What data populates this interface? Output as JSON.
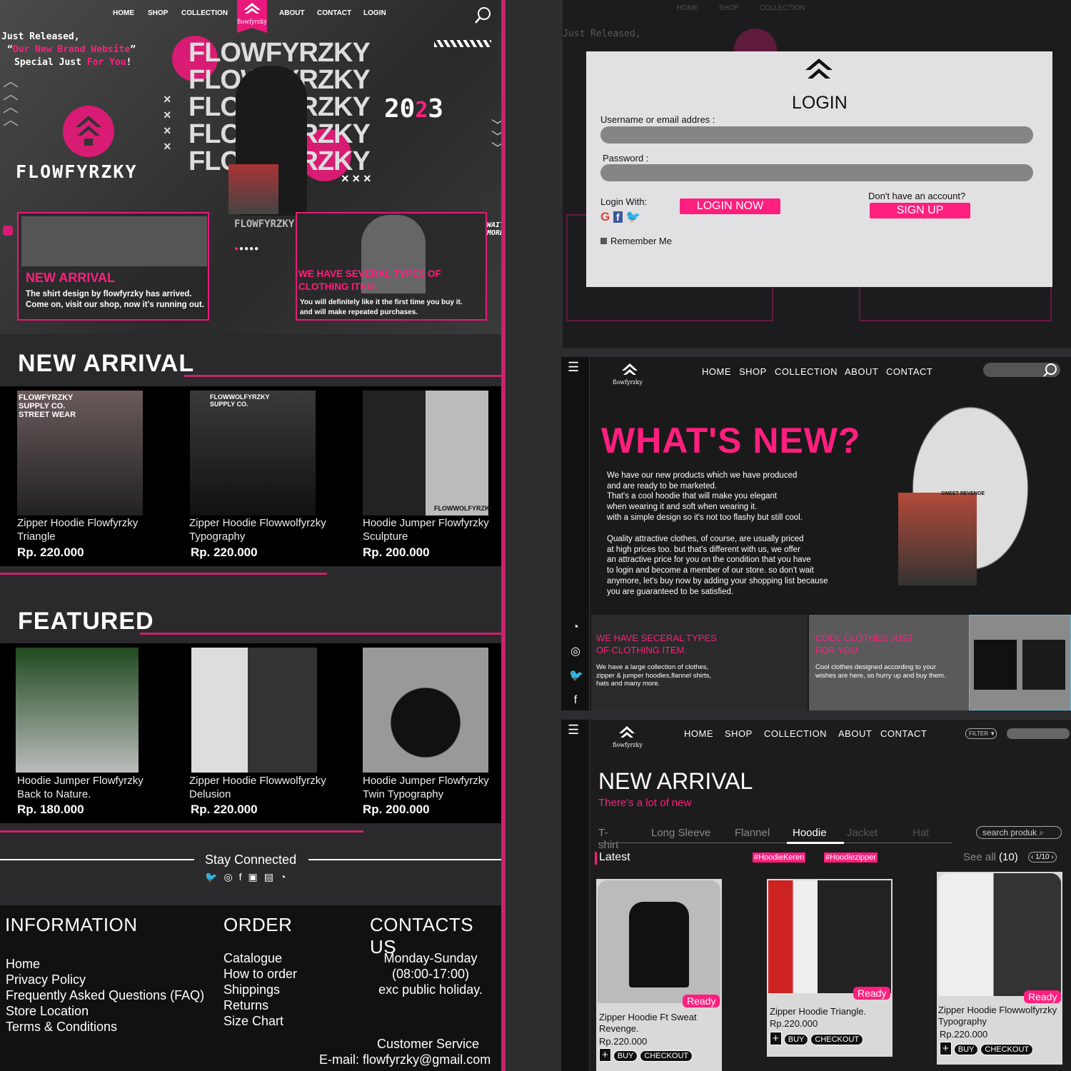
{
  "nav": {
    "home": "HOME",
    "shop": "SHOP",
    "collection": "COLLECTION",
    "about": "ABOUT",
    "contact": "CONTACT",
    "login": "LOGIN",
    "brand": "flowfyrzky"
  },
  "hero": {
    "l1": "Just Released,",
    "l2a": "“",
    "l2b": "Our New Brand Website",
    "l2c": "”",
    "l3a": "Special Just ",
    "l3b": "For You",
    "l3c": "!",
    "wordmark": "FLOWFYRZKY",
    "stack": [
      "FLOWFYRZKY",
      "FLOWFYRZKY",
      "FLOWFYRZKY",
      "FLOWFYRZKY",
      "FLOWFYRZKY"
    ],
    "year_a": "20",
    "year_b": "2",
    "year_c": "3",
    "logo_text": "FLOWFYRZKY",
    "wait": "WAIT",
    "more": "MORE"
  },
  "promo": [
    {
      "title": "NEW ARRIVAL",
      "body": "The shirt design by flowfyrzky has arrived. Come on, visit our shop, now it's running out."
    },
    {
      "title": "WE HAVE SEVERAL TYPES OF CLOTHING ITEM.",
      "body": "You will definitely like it the first time you buy it. and will make repeated purchases."
    }
  ],
  "new_arrival": {
    "title": "NEW ARRIVAL",
    "items": [
      {
        "name": "Zipper Hoodie Flowfyrzky Triangle",
        "price": "Rp. 220.000",
        "img_label": "FLOWFYRZKY SUPPLY CO. STREET WEAR"
      },
      {
        "name": "Zipper Hoodie Flowwolfyrzky Typography",
        "price": "Rp. 220.000",
        "img_label": "FLOWWOLFYRZKY SUPPLY CO."
      },
      {
        "name": "Hoodie Jumper Flowfyrzky Sculpture",
        "price": "Rp. 200.000",
        "img_label": "FLOWWOLFYRZKY"
      }
    ]
  },
  "featured": {
    "title": "FEATURED",
    "items": [
      {
        "name": "Hoodie Jumper Flowfyrzky Back to Nature.",
        "price": "Rp. 180.000"
      },
      {
        "name": "Zipper Hoodie Flowwolfyrzky Delusion",
        "price": "Rp. 220.000"
      },
      {
        "name": "Hoodie Jumper Flowfyrzky Twin Typography",
        "price": "Rp. 200.000"
      }
    ]
  },
  "stay": "Stay Connected",
  "footer": {
    "info_title": "INFORMATION",
    "info": [
      "Home",
      "Privacy Policy",
      "Frequently Asked Questions (FAQ)",
      "Store Location",
      "Terms & Conditions"
    ],
    "order_title": "ORDER",
    "order": [
      "Catalogue",
      "How to order",
      "Shippings",
      "Returns",
      "Size Chart"
    ],
    "contact_title": "CONTACTS US",
    "hours": [
      "Monday-Sunday",
      "(08:00-17:00)",
      "exc public holiday."
    ],
    "cs": "Customer Service",
    "email": "E-mail: flowfyrzky@gmail.com"
  },
  "login": {
    "title": "LOGIN",
    "user_label": "Username or email addres :",
    "pass_label": "Password :",
    "login_with": "Login With:",
    "login_btn": "LOGIN NOW",
    "no_account": "Don't have an account?",
    "signup_btn": "SIGN UP",
    "remember": "Remember Me"
  },
  "whats": {
    "title": "WHAT'S NEW?",
    "p1": [
      "We have our new products which we have produced",
      "and are ready to be marketed.",
      "That's a cool hoodie that will make you elegant",
      "when wearing it and soft when wearing it.",
      "with a simple design so it's not too flashy but still cool."
    ],
    "p2": [
      "Quality attractive clothes, of course, are usually priced",
      "at high prices too. but that's different with us, we offer",
      "an attractive price for you on the condition that you have",
      "to login and become a member of our store. so don't wait",
      "anymore, let's buy now by adding your shopping list because",
      "you are guaranteed to be satisfied."
    ],
    "card1_title": [
      "WE HAVE SECERAL TYPES",
      "OF CLOTHING ITEM."
    ],
    "card1_body": [
      "We have a large collection of clothes,",
      "zipper & jumper hoodies,flannel shirts,",
      "hats and many more."
    ],
    "card2_title": [
      "COOL CLOTHES JUST",
      "FOR YOU"
    ],
    "card2_body": [
      "Cool clothes designed according to your",
      "wishes are here, so hurry up and buy them."
    ],
    "hoodie_text": "SWEET REVENGE"
  },
  "shop": {
    "title": "NEW ARRIVAL",
    "subtitle": "There's a lot of new",
    "filter": "FILTER",
    "tabs": [
      "T-shirt",
      "Long Sleeve",
      "Flannel",
      "Hoodie",
      "Jacket",
      "Hat"
    ],
    "search_placeholder": "search produk",
    "latest": "Latest",
    "tag1": "#HoodieKeren",
    "tag2": "#Hoodiezipper",
    "see_all": "See all",
    "count": "(10)",
    "page": "1/10",
    "ready": "Ready",
    "buy": "BUY",
    "checkout": "CHECKOUT",
    "items": [
      {
        "name": "Zipper Hoodie Ft Sweat Revenge.",
        "price": "Rp.220.000"
      },
      {
        "name": "Zipper Hoodie Triangle.",
        "price": "Rp.220.000"
      },
      {
        "name": "Zipper Hoodie Flowwolfyrzky Typography",
        "price": "Rp.220.000"
      }
    ]
  }
}
